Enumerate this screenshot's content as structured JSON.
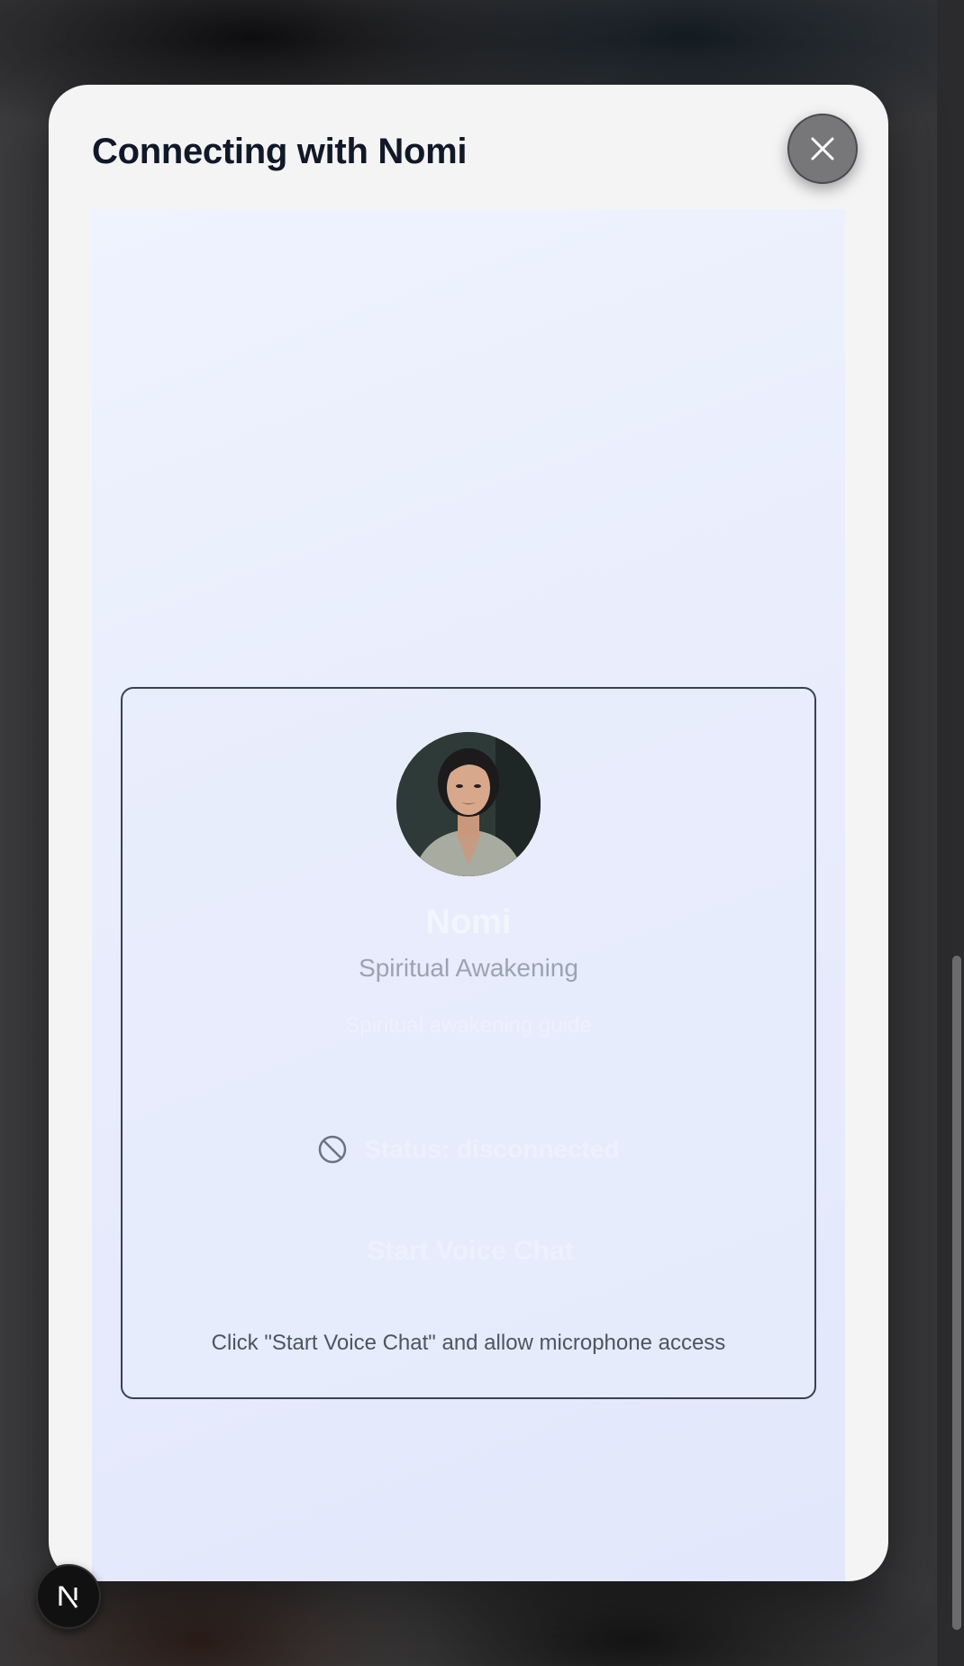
{
  "modal": {
    "title": "Connecting with Nomi",
    "close_icon": "close-icon"
  },
  "card": {
    "avatar_icon": "avatar-portrait",
    "name": "Nomi",
    "role": "Spiritual Awakening",
    "description": "Spiritual awakening guide",
    "status_icon": "blocked-icon",
    "status": "Status: disconnected",
    "start_button": "Start Voice Chat",
    "helper": "Click \"Start Voice Chat\" and allow microphone access"
  },
  "badge": {
    "icon": "nextjs-logo-icon"
  },
  "colors": {
    "modal_bg": "#f4f4f5",
    "content_bg": "#e8ecfc",
    "title": "#111827",
    "role": "#9ca3af",
    "helper": "#4b5563"
  }
}
